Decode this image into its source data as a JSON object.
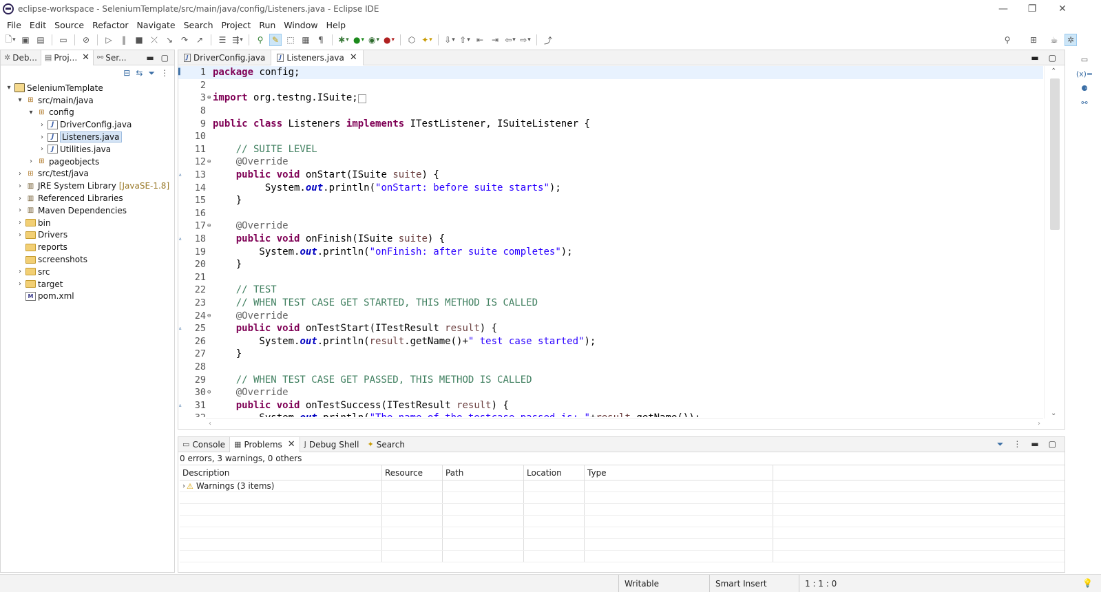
{
  "window": {
    "title": "eclipse-workspace - SeleniumTemplate/src/main/java/config/Listeners.java - Eclipse IDE",
    "minimize": "—",
    "restore": "❐",
    "close": "✕"
  },
  "menu": [
    "File",
    "Edit",
    "Source",
    "Refactor",
    "Navigate",
    "Search",
    "Project",
    "Run",
    "Window",
    "Help"
  ],
  "left_panel": {
    "tabs": [
      {
        "label": "Deb...",
        "icon": "bug-icon"
      },
      {
        "label": "Proj...",
        "icon": "package-explorer-icon"
      },
      {
        "label": "Ser...",
        "icon": "servers-icon"
      }
    ],
    "tree": [
      {
        "label": "SeleniumTemplate",
        "level": 0,
        "arrow": "▾",
        "icon": "project"
      },
      {
        "label": "src/main/java",
        "level": 1,
        "arrow": "▾",
        "icon": "srcfolder"
      },
      {
        "label": "config",
        "level": 2,
        "arrow": "▾",
        "icon": "package"
      },
      {
        "label": "DriverConfig.java",
        "level": 3,
        "arrow": "›",
        "icon": "java"
      },
      {
        "label": "Listeners.java",
        "level": 3,
        "arrow": "›",
        "icon": "java",
        "selected": true
      },
      {
        "label": "Utilities.java",
        "level": 3,
        "arrow": "›",
        "icon": "java"
      },
      {
        "label": "pageobjects",
        "level": 2,
        "arrow": "›",
        "icon": "package"
      },
      {
        "label": "src/test/java",
        "level": 1,
        "arrow": "›",
        "icon": "srcfolder"
      },
      {
        "label": "JRE System Library",
        "extra": "[JavaSE-1.8]",
        "level": 1,
        "arrow": "›",
        "icon": "library"
      },
      {
        "label": "Referenced Libraries",
        "level": 1,
        "arrow": "›",
        "icon": "library"
      },
      {
        "label": "Maven Dependencies",
        "level": 1,
        "arrow": "›",
        "icon": "library"
      },
      {
        "label": "bin",
        "level": 1,
        "arrow": "›",
        "icon": "folder"
      },
      {
        "label": "Drivers",
        "level": 1,
        "arrow": "›",
        "icon": "folder"
      },
      {
        "label": "reports",
        "level": 1,
        "arrow": "",
        "icon": "folder"
      },
      {
        "label": "screenshots",
        "level": 1,
        "arrow": "",
        "icon": "folder"
      },
      {
        "label": "src",
        "level": 1,
        "arrow": "›",
        "icon": "folder"
      },
      {
        "label": "target",
        "level": 1,
        "arrow": "›",
        "icon": "folder"
      },
      {
        "label": "pom.xml",
        "level": 1,
        "arrow": "",
        "icon": "xml"
      }
    ]
  },
  "editor": {
    "tabs": [
      {
        "label": "DriverConfig.java",
        "active": false
      },
      {
        "label": "Listeners.java",
        "active": true
      }
    ],
    "lines": [
      {
        "n": "1",
        "html": "<span class='kw'>package</span> config;",
        "cur": true
      },
      {
        "n": "2",
        "html": ""
      },
      {
        "n": "3",
        "fold": "⊕",
        "html": "<span class='kw'>import</span> org.testng.ISuite;<span style='border:1px solid #999;font-size:10px;padding:0 2px'> </span>"
      },
      {
        "n": "8",
        "html": ""
      },
      {
        "n": "9",
        "html": "<span class='kw'>public</span> <span class='kw'>class</span> Listeners <span class='kw'>implements</span> ITestListener, ISuiteListener {"
      },
      {
        "n": "10",
        "html": ""
      },
      {
        "n": "11",
        "html": "    <span class='cm'>// SUITE LEVEL</span>"
      },
      {
        "n": "12",
        "fold": "⊖",
        "html": "    <span class='an'>@Override</span>"
      },
      {
        "n": "13",
        "mark": "▵",
        "html": "    <span class='kw'>public</span> <span class='kw'>void</span> onStart(ISuite <span class='pv'>suite</span>) {"
      },
      {
        "n": "14",
        "html": "         System.<span class='fi'>out</span>.println(<span class='st'>\"onStart: before suite starts\"</span>);"
      },
      {
        "n": "15",
        "html": "    }"
      },
      {
        "n": "16",
        "html": ""
      },
      {
        "n": "17",
        "fold": "⊖",
        "html": "    <span class='an'>@Override</span>"
      },
      {
        "n": "18",
        "mark": "▵",
        "html": "    <span class='kw'>public</span> <span class='kw'>void</span> onFinish(ISuite <span class='pv'>suite</span>) {"
      },
      {
        "n": "19",
        "html": "        System.<span class='fi'>out</span>.println(<span class='st'>\"onFinish: after suite completes\"</span>);"
      },
      {
        "n": "20",
        "html": "    }"
      },
      {
        "n": "21",
        "html": ""
      },
      {
        "n": "22",
        "html": "    <span class='cm'>// TEST</span>"
      },
      {
        "n": "23",
        "html": "    <span class='cm'>// WHEN TEST CASE GET STARTED, THIS METHOD IS CALLED</span>"
      },
      {
        "n": "24",
        "fold": "⊖",
        "html": "    <span class='an'>@Override</span>"
      },
      {
        "n": "25",
        "mark": "▵",
        "html": "    <span class='kw'>public</span> <span class='kw'>void</span> onTestStart(ITestResult <span class='pv'>result</span>) {"
      },
      {
        "n": "26",
        "html": "        System.<span class='fi'>out</span>.println(<span class='pv'>result</span>.getName()+<span class='st'>\" test case started\"</span>);"
      },
      {
        "n": "27",
        "html": "    }"
      },
      {
        "n": "28",
        "html": ""
      },
      {
        "n": "29",
        "html": "    <span class='cm'>// WHEN TEST CASE GET PASSED, THIS METHOD IS CALLED</span>"
      },
      {
        "n": "30",
        "fold": "⊖",
        "html": "    <span class='an'>@Override</span>"
      },
      {
        "n": "31",
        "mark": "▵",
        "html": "    <span class='kw'>public</span> <span class='kw'>void</span> onTestSuccess(ITestResult <span class='pv'>result</span>) {"
      },
      {
        "n": "32",
        "html": "        System.<span class='fi'>out</span>.println(<span class='st'>\"The name of the testcase passed is: \"</span>+<span class='pv'>result</span>.getName());"
      }
    ]
  },
  "bottom_panel": {
    "tabs": [
      {
        "label": "Console",
        "icon": "console-icon",
        "active": false
      },
      {
        "label": "Problems",
        "icon": "problems-icon",
        "active": true
      },
      {
        "label": "Debug Shell",
        "icon": "debug-shell-icon",
        "active": false
      },
      {
        "label": "Search",
        "icon": "search-icon",
        "active": false
      }
    ],
    "summary": "0 errors, 3 warnings, 0 others",
    "columns": [
      "Description",
      "Resource",
      "Path",
      "Location",
      "Type"
    ],
    "warnings_row": "Warnings (3 items)"
  },
  "statusbar": {
    "writable": "Writable",
    "insert_mode": "Smart Insert",
    "position": "1 : 1 : 0"
  }
}
